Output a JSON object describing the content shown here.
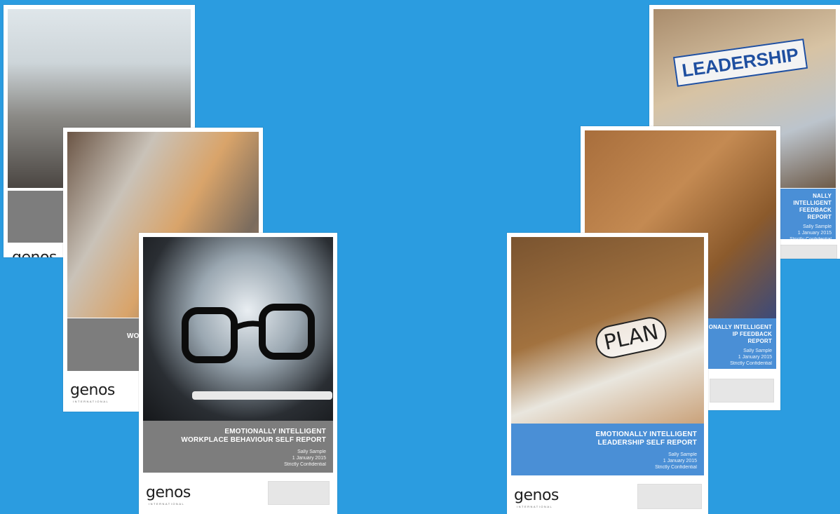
{
  "colors": {
    "background": "#2b9ce0",
    "gray_band": "#7d7d7d",
    "blue_band": "#4a8fd6"
  },
  "covers": {
    "l1": {
      "logo": "genos"
    },
    "l2": {
      "title": "WOR",
      "logo": "genos",
      "logo_sub": "INTERNATIONAL"
    },
    "l3": {
      "title1": "EMOTIONALLY INTELLIGENT",
      "title2": "WORKPLACE BEHAVIOUR SELF REPORT",
      "name": "Sally Sample",
      "date": "1 January 2015",
      "conf": "Strictly Confidential",
      "logo": "genos",
      "logo_sub": "INTERNATIONAL"
    },
    "r1": {
      "photo_text": "LEADERSHIP",
      "title1": "NALLY INTELLIGENT",
      "title2": "FEEDBACK REPORT",
      "name": "Sally Sample",
      "date": "1 January 2015",
      "conf": "Strictly Confidential"
    },
    "r2": {
      "title1": "IONALLY INTELLIGENT",
      "title2": "IP FEEDBACK REPORT",
      "name": "Sally Sample",
      "date": "1 January 2015",
      "conf": "Strictly Confidential"
    },
    "r3": {
      "photo_text": "PLAN",
      "title1": "EMOTIONALLY INTELLIGENT",
      "title2": "LEADERSHIP SELF REPORT",
      "name": "Sally Sample",
      "date": "1 January 2015",
      "conf": "Strictly Confidential",
      "logo": "genos",
      "logo_sub": "INTERNATIONAL"
    }
  }
}
